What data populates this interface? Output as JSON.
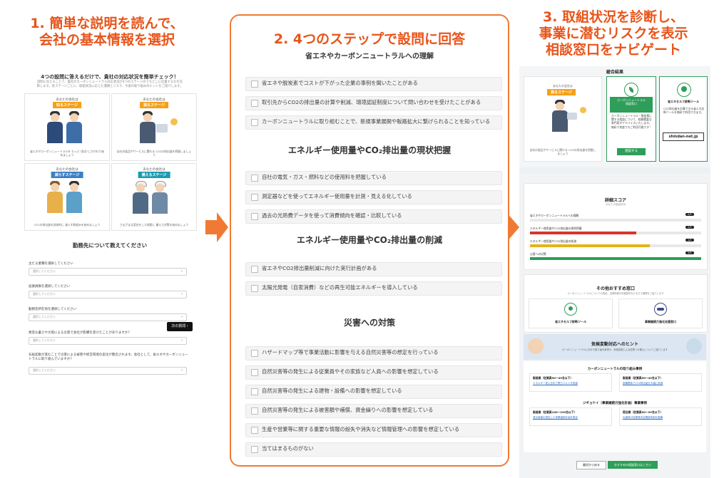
{
  "headers": {
    "left": [
      "1. 簡単な説明を読んで、",
      "会社の基本情報を選択"
    ],
    "mid": "2. 4つのステップで設問に回答",
    "right": [
      "3. 取組状況を診断し、",
      "事業に潜むリスクを表示",
      "相談窓口をナビゲート"
    ]
  },
  "left": {
    "title": "4つの設問に答えるだけで、貴社の対応状況を簡単チェック！",
    "subtitle": "説明に答えることで、貴社のカーボンニュートラル対応状況が4つのステージのうちどこに位置するかを診断します。各ステージごとに、取組状況に応じた課題とリスク、今後の取り組みのヒントをご紹介します。",
    "cards": [
      {
        "top": "あなたの会社は",
        "badge": "知るステージ",
        "desc": "省エネやカーボンニュートラルを\nもっと“身近”にかかわり始めましょう"
      },
      {
        "top": "あなたの会社は",
        "badge": "測るステージ",
        "desc": "自社の製品やサービスに関わる\nCO2の排出量を把握しましょう"
      },
      {
        "top": "あなたの会社は",
        "badge": "減らすステージ",
        "desc": "CO2の排出量を具体的に\n減らす取組みを始めましょう"
      },
      {
        "top": "あなたの会社は",
        "badge": "備えるステージ",
        "desc": "さまざまな変化をした周囲に\n備えた対策を始めましょう"
      }
    ],
    "section_title": "勤務先について教えてください",
    "questions": [
      {
        "label": "主たる業種を選択してください",
        "placeholder": "選択してください"
      },
      {
        "label": "従業員数を選択してください",
        "placeholder": "選択してください"
      },
      {
        "label": "勤務先所在地を選択してください",
        "placeholder": "選択してください"
      },
      {
        "label": "異常な暑さや大雨による災害で会社が影響を受けたことがありますか？",
        "placeholder": "選択してください"
      },
      {
        "label": "気候変動が進むことで災害による被害や経営環境の変化が懸念されます。会社として、省エネやカーボンニュートラルに取り組んでいますか？",
        "placeholder": "選択してください"
      }
    ],
    "next_label": "次の質問 ›"
  },
  "mid": {
    "sections": [
      {
        "title": "省エネやカーボンニュートラルへの理解",
        "items": [
          "省エネや脱炭素でコストが下がった企業の事例を聞いたことがある",
          "取引先からCO2の排出量の計算や削減、環境認証制度について問い合わせを受けたことがある",
          "カーボンニュートラルに取り組むことで、新規事業展開や販路拡大に繋げられることを知っている"
        ]
      },
      {
        "title": "エネルギー使用量やCO₂排出量の現状把握",
        "items": [
          "自社の電気・ガス・燃料などの使用料を把握している",
          "測定器などを使ってエネルギー使用量を計測・見える化している",
          "過去の光熱費データを使って消費傾向を確認・比較している"
        ]
      },
      {
        "title": "エネルギー使用量やCO₂排出量の削減",
        "items": [
          "省エネやCO2排出量削減に向けた実行計画がある",
          "太陽光発電（自家消費）などの再生可能エネルギーを導入している"
        ]
      },
      {
        "title": "災害への対策",
        "items": [
          "ハザードマップ等で事業活動に影響を与える自然災害等の想定を行っている",
          "自然災害等の発生による従業員やその家族など人員への影響を想定している",
          "自然災害等の発生による建物・設備への影響を想定している",
          "自然災害等の発生による被害額や補償、資金繰りへの影響を想定している",
          "生産や営業等に関する重要な情報の紛失や消失など情報管理への影響を想定している",
          "当てはまるものがない"
        ]
      }
    ]
  },
  "right": {
    "result_title": "総合結果",
    "result_card": {
      "top": "あなたの会社は",
      "badge": "測るステージ",
      "desc": "自社の製品やサービスに関わる\nCO2の排出量を把握しましょう"
    },
    "consult_card": {
      "title": "カーボンニュートラル\n相談窓口",
      "desc": "カーボンニュートラル・脱炭素に関する相談について、経験豊富な専門家がアドバイスいたします。無料で何度でもご利用可能です！",
      "button": "相談する"
    },
    "tool_card": {
      "title": "省エネセルフ診断ツール",
      "desc": "CO2排出量を計算できる省エネ診断ツールを無料で利用できます。",
      "logo": "shindan-net.jp"
    },
    "score": {
      "title": "詳細スコア",
      "subtitle": "あなたの取組状況",
      "rows": [
        {
          "label": "省エネやカーボンニュートラルへの理解",
          "value": 0.0,
          "color": "#d9342b",
          "tag": "0/3"
        },
        {
          "label": "エネルギー使用量やCO2排出量の現状把握",
          "value": 0.62,
          "color": "#d9342b",
          "tag": "2/3"
        },
        {
          "label": "エネルギー使用量やCO2排出量の削減",
          "value": 0.7,
          "color": "#e6b319",
          "tag": "1/2"
        },
        {
          "label": "災害への対策",
          "value": 1.0,
          "color": "#2e9e58",
          "tag": "5/5"
        }
      ]
    },
    "recommend": {
      "title": "その他おすすめ窓口",
      "sub": "カーボンニュートラルについての相談、支援制度の情報提供などを行う機関をご紹介します",
      "items": [
        "省エネセルフ診断ツール",
        "事業継続力強化支援窓口"
      ]
    },
    "hint": {
      "title": "気候変動対応へのヒント",
      "sub": "カーボンニュートラルに向けた取り組み事例や、気候変動による影響への備えについてご紹介します",
      "sec1": "カーボンニュートラルの取り組み事例",
      "cards1": [
        {
          "t": "製造業（従業員50〜49名以下）",
          "l": "エネルギー見える化で電力コストを削減"
        },
        {
          "t": "製造業（従業員50〜49名以下）",
          "l": "設備更新でCO2排出量を大幅に削減"
        }
      ],
      "sec2": "ジギョケイ（事業継続力強化計画）事業事例",
      "cards2": [
        {
          "t": "製造業（従業員100〜299名以下）",
          "l": "浸水被害を想定した事業継続計画を策定"
        },
        {
          "t": "宿泊業（従業員50〜99名以下）",
          "l": "災害時の従業員安否確認体制を整備"
        }
      ],
      "back": "最初から戻る",
      "more": "おすすめの相談窓口はこちら"
    }
  },
  "colors": {
    "accent": "#e8541a",
    "green": "#2e9e58",
    "badge_orange": "#f5a017",
    "badge_blue": "#3b7fc4",
    "badge_teal": "#1a9bb0"
  }
}
